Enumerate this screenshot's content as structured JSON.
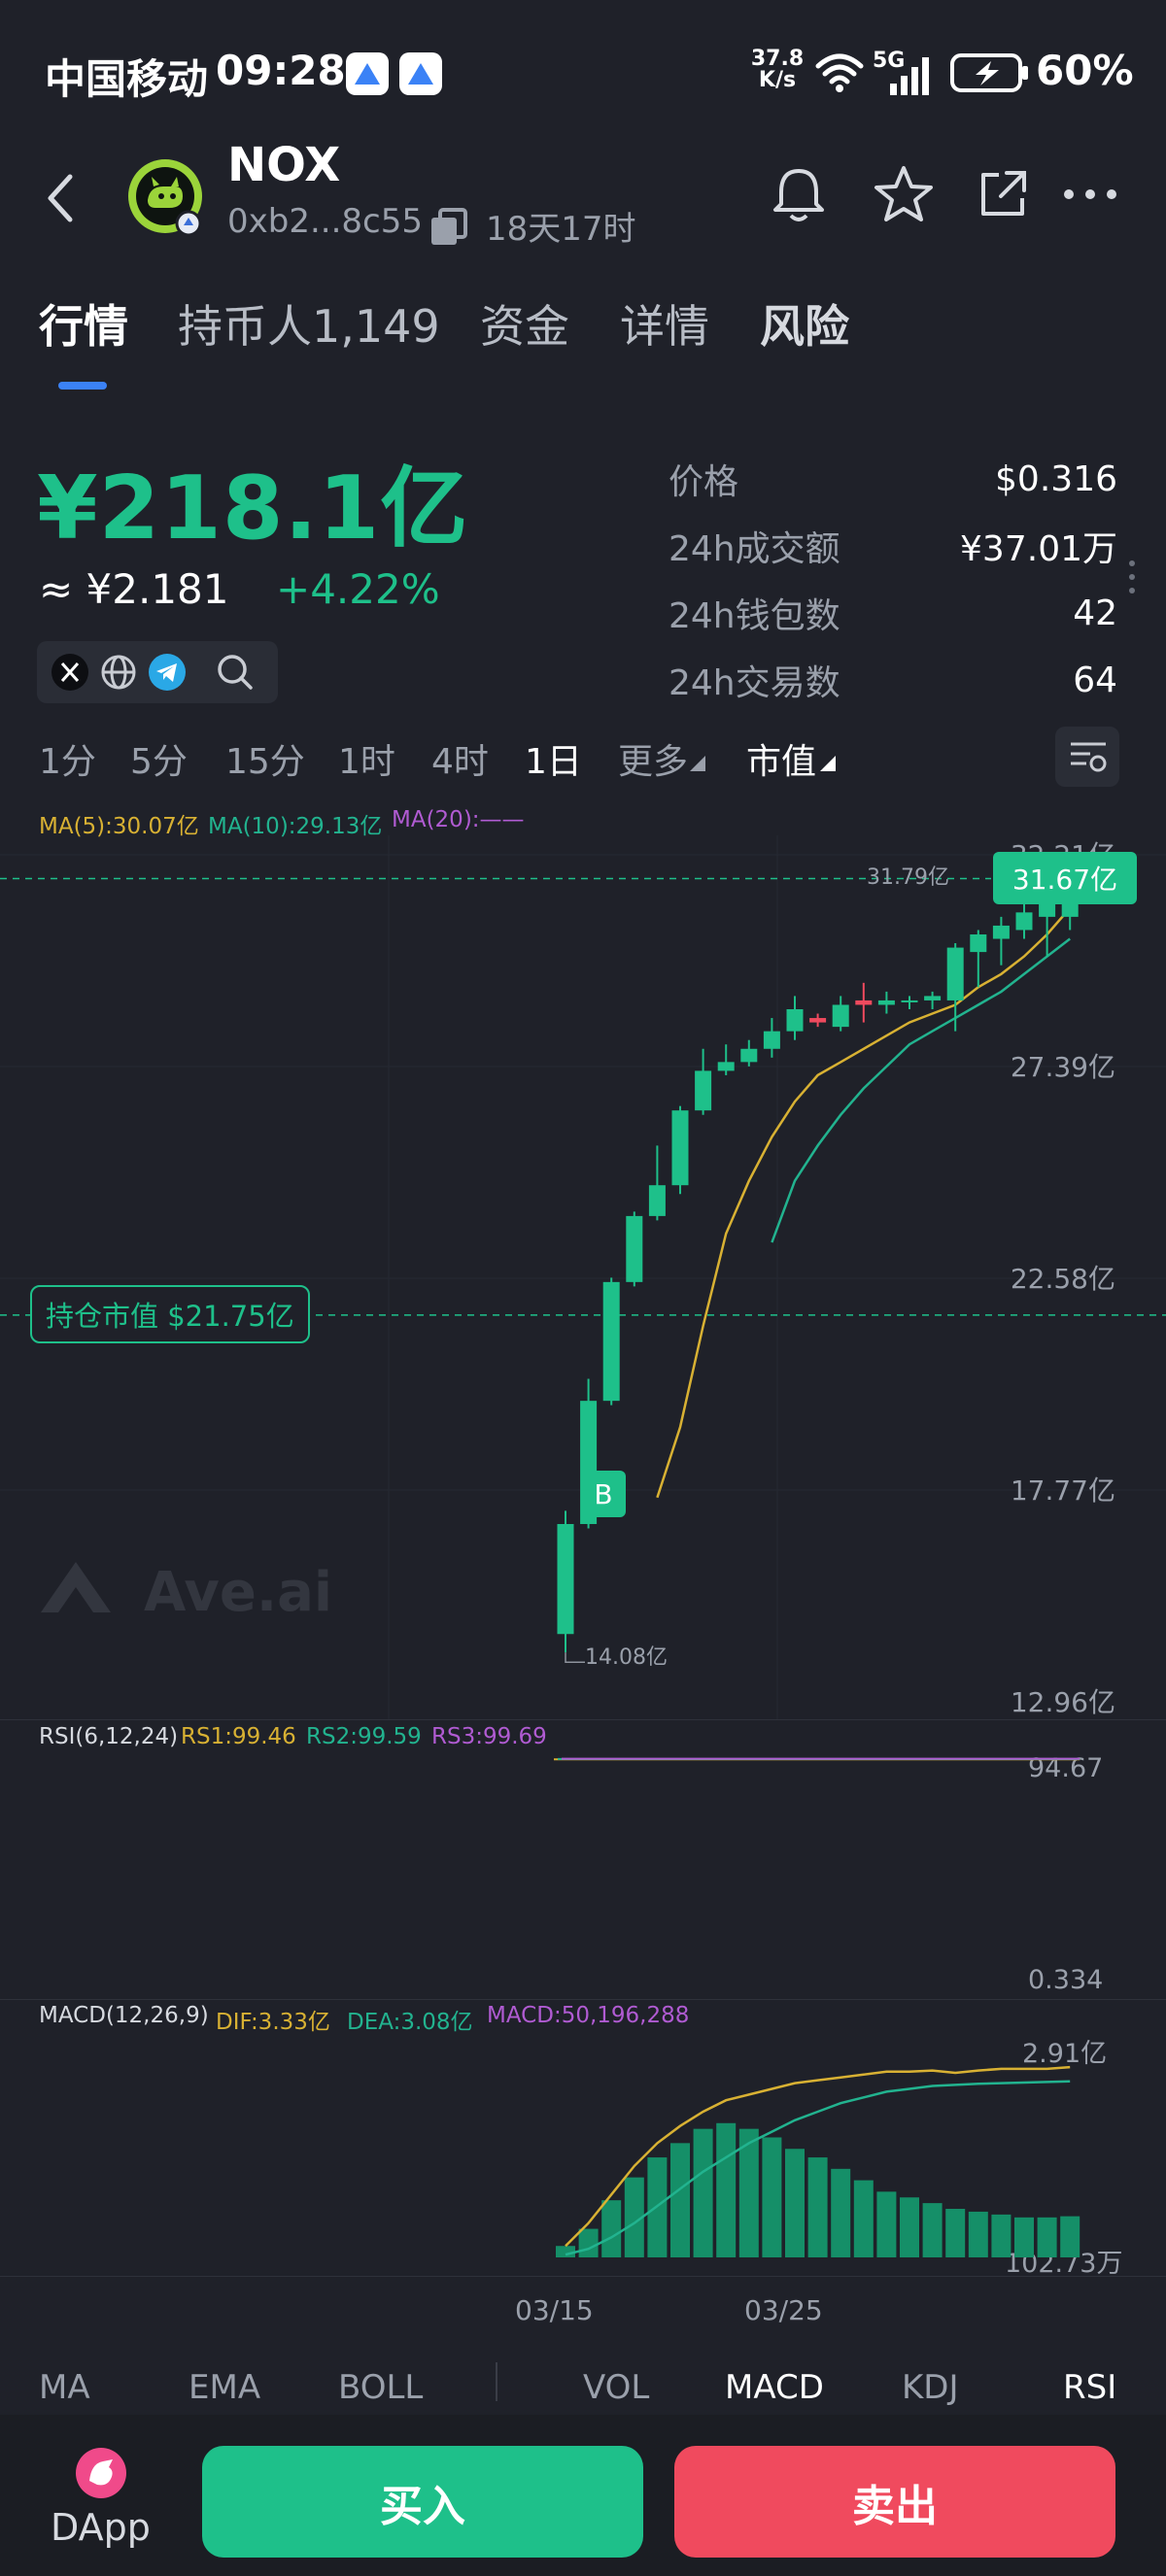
{
  "status_bar": {
    "carrier": "中国移动",
    "time": "09:28",
    "net_speed_value": "37.8",
    "net_speed_unit": "K/s",
    "network": "5G",
    "battery": "60%"
  },
  "header": {
    "token_name": "NOX",
    "address": "0xb2...8c55",
    "age": "18天17时"
  },
  "tabs": [
    {
      "label": "行情"
    },
    {
      "label": "持币人1,149"
    },
    {
      "label": "资金"
    },
    {
      "label": "详情"
    },
    {
      "label": "风险"
    }
  ],
  "market_cap": {
    "value": "¥218.1亿",
    "price_approx": "≈ ¥2.181",
    "change": "+4.22%"
  },
  "stats": [
    {
      "label": "价格",
      "value": "$0.316"
    },
    {
      "label": "24h成交额",
      "value": "¥37.01万"
    },
    {
      "label": "24h钱包数",
      "value": "42"
    },
    {
      "label": "24h交易数",
      "value": "64"
    }
  ],
  "timeframes": [
    {
      "label": "1分"
    },
    {
      "label": "5分"
    },
    {
      "label": "15分"
    },
    {
      "label": "1时"
    },
    {
      "label": "4时"
    },
    {
      "label": "1日"
    },
    {
      "label": "更多"
    },
    {
      "label": "市值"
    }
  ],
  "ma_legend": {
    "ma5": "MA(5):30.07亿",
    "ma10": "MA(10):29.13亿",
    "ma20": "MA(20):——"
  },
  "colors": {
    "up": "#1ec08a",
    "down": "#f04a5e",
    "ma5": "#d8b133",
    "ma10": "#22b38f",
    "ma20": "#b05bd2",
    "background": "#1f2129"
  },
  "main_chart": {
    "y_labels": [
      "32.21亿",
      "27.39亿",
      "22.58亿",
      "17.77亿",
      "12.96亿"
    ],
    "current_label": "31.67亿",
    "high_label": "31.79亿",
    "low_label": "14.08亿",
    "position_label": "持仓市值 $21.75亿",
    "buy_marker": "B",
    "watermark": "Ave.ai"
  },
  "chart_data": {
    "type": "candlestick",
    "y_unit": "亿",
    "ylim": [
      12.96,
      32.21
    ],
    "current_value": 31.67,
    "high": 31.79,
    "low": 14.08,
    "position_value": 21.75,
    "candles": [
      {
        "o": 14.5,
        "c": 17.0,
        "h": 17.3,
        "l": 14.08
      },
      {
        "o": 17.0,
        "c": 19.8,
        "h": 20.3,
        "l": 16.9
      },
      {
        "o": 19.8,
        "c": 22.5,
        "h": 22.6,
        "l": 19.7
      },
      {
        "o": 22.5,
        "c": 24.0,
        "h": 24.1,
        "l": 22.4
      },
      {
        "o": 24.0,
        "c": 24.7,
        "h": 25.6,
        "l": 23.9
      },
      {
        "o": 24.7,
        "c": 26.4,
        "h": 26.5,
        "l": 24.5
      },
      {
        "o": 26.4,
        "c": 27.3,
        "h": 27.8,
        "l": 26.3
      },
      {
        "o": 27.3,
        "c": 27.5,
        "h": 27.9,
        "l": 27.2
      },
      {
        "o": 27.5,
        "c": 27.8,
        "h": 28.0,
        "l": 27.4
      },
      {
        "o": 27.8,
        "c": 28.2,
        "h": 28.5,
        "l": 27.6
      },
      {
        "o": 28.2,
        "c": 28.7,
        "h": 29.0,
        "l": 28.0
      },
      {
        "o": 28.5,
        "c": 28.4,
        "h": 28.6,
        "l": 28.3
      },
      {
        "o": 28.3,
        "c": 28.8,
        "h": 29.0,
        "l": 28.2
      },
      {
        "o": 28.9,
        "c": 28.8,
        "h": 29.3,
        "l": 28.4
      },
      {
        "o": 28.8,
        "c": 28.9,
        "h": 29.1,
        "l": 28.6
      },
      {
        "o": 28.9,
        "c": 28.9,
        "h": 29.0,
        "l": 28.7
      },
      {
        "o": 28.9,
        "c": 29.0,
        "h": 29.1,
        "l": 28.7
      },
      {
        "o": 28.9,
        "c": 30.1,
        "h": 30.2,
        "l": 28.2
      },
      {
        "o": 30.0,
        "c": 30.4,
        "h": 30.5,
        "l": 29.2
      },
      {
        "o": 30.3,
        "c": 30.6,
        "h": 30.8,
        "l": 29.7
      },
      {
        "o": 30.5,
        "c": 30.9,
        "h": 31.3,
        "l": 30.3
      },
      {
        "o": 30.8,
        "c": 31.1,
        "h": 31.5,
        "l": 29.9
      },
      {
        "o": 30.8,
        "c": 31.67,
        "h": 31.79,
        "l": 30.5
      }
    ],
    "ma5": [
      null,
      null,
      null,
      null,
      17.6,
      19.2,
      21.5,
      23.6,
      24.8,
      25.8,
      26.6,
      27.2,
      27.5,
      27.8,
      28.1,
      28.4,
      28.6,
      28.8,
      29.2,
      29.5,
      29.9,
      30.4,
      31.0
    ],
    "ma10": [
      null,
      null,
      null,
      null,
      null,
      null,
      null,
      null,
      null,
      23.4,
      24.8,
      25.6,
      26.3,
      26.9,
      27.4,
      27.9,
      28.2,
      28.5,
      28.8,
      29.1,
      29.5,
      29.9,
      30.3
    ],
    "x_labels": [
      {
        "index": 0,
        "label": "03/15"
      },
      {
        "index": 10,
        "label": "03/25"
      }
    ]
  },
  "rsi": {
    "header": "RSI(6,12,24)",
    "rs1": "RS1:99.46",
    "rs2": "RS2:99.59",
    "rs3": "RS3:99.69",
    "y_top": "94.67",
    "y_bottom": "0.334",
    "rs1_value": 99.46,
    "rs2_value": 99.59,
    "rs3_value": 99.69
  },
  "macd": {
    "header": "MACD(12,26,9)",
    "dif": "DIF:3.33亿",
    "dea": "DEA:3.08亿",
    "macd": "MACD:50,196,288",
    "y_top": "2.91亿",
    "y_bottom": "102.73万",
    "hist": [
      0.2,
      0.5,
      1.0,
      1.4,
      1.75,
      2.0,
      2.25,
      2.35,
      2.25,
      2.1,
      1.9,
      1.75,
      1.55,
      1.35,
      1.15,
      1.05,
      0.95,
      0.85,
      0.8,
      0.75,
      0.7,
      0.7,
      0.72
    ],
    "dif_line": [
      0.2,
      0.6,
      1.1,
      1.6,
      2.0,
      2.3,
      2.55,
      2.75,
      2.85,
      2.95,
      3.05,
      3.1,
      3.15,
      3.2,
      3.25,
      3.25,
      3.27,
      3.23,
      3.27,
      3.3,
      3.3,
      3.3,
      3.33
    ],
    "dea_line": [
      0.05,
      0.15,
      0.35,
      0.6,
      0.9,
      1.2,
      1.5,
      1.75,
      2.0,
      2.2,
      2.4,
      2.55,
      2.7,
      2.8,
      2.9,
      2.95,
      3.0,
      3.02,
      3.04,
      3.05,
      3.06,
      3.07,
      3.08
    ]
  },
  "indicator_tabs": [
    {
      "label": "MA"
    },
    {
      "label": "EMA"
    },
    {
      "label": "BOLL"
    },
    {
      "label": "VOL"
    },
    {
      "label": "MACD"
    },
    {
      "label": "KDJ"
    },
    {
      "label": "RSI"
    }
  ],
  "bottom_bar": {
    "dapp_label": "DApp",
    "buy_label": "买入",
    "sell_label": "卖出"
  }
}
